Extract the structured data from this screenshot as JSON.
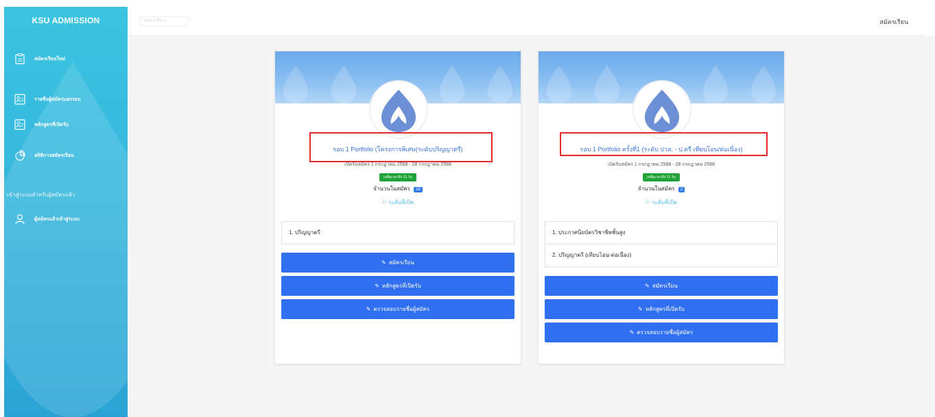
{
  "sidebar": {
    "title": "KSU ADMISSION",
    "items": [
      {
        "label": "สมัครเรียนใหม่",
        "icon": "clipboard-icon"
      },
      {
        "label": "รายชื่อผู้สมัครแยกรอบ",
        "icon": "user-list-icon"
      },
      {
        "label": "หลักสูตรที่เปิดรับ",
        "icon": "course-icon"
      },
      {
        "label": "สถิติการสมัครเรียน",
        "icon": "pie-chart-icon"
      }
    ],
    "section_label": "เข้าสู่ระบบสำหรับผู้สมัครแล้ว",
    "login_item": {
      "label": "ผู้สมัครแล้วเข้าสู่ระบบ",
      "icon": "user-icon"
    }
  },
  "topbar": {
    "crumb": "สมัครเรียน",
    "right_link": "สมัครเรียน"
  },
  "cards": [
    {
      "title": "รอบ 1 Portfolio (โครงการพิเศษ(ระดับปริญญาตรี)",
      "period": "เปิดรับสมัคร 1 กรกฎาคม 2568 - 28 กรกฎาคม 2568",
      "badge": "เหลือเวลาอีก 11 วัน",
      "count_label": "จำนวนในสมัคร",
      "count": "18",
      "levels_label": "ระดับที่เปิด",
      "levels": [
        "1. ปริญญาตรี"
      ],
      "buttons": {
        "apply": "สมัครเรียน",
        "courses": "หลักสูตรที่เปิดรับ",
        "check": "ตรวจสอบรายชื่อผู้สมัคร"
      }
    },
    {
      "title": "รอบ 1 Portfolio ครั้งที่1 (ระดับ ปวส. - ป.ตรี เทียบโอน/ต่อเนื่อง)",
      "period": "เปิดรับสมัคร 1 กรกฎาคม 2568 - 28 กรกฎาคม 2568",
      "badge": "เหลือเวลาอีก 11 วัน",
      "count_label": "จำนวนในสมัคร",
      "count": "2",
      "levels_label": "ระดับที่เปิด",
      "levels": [
        "1. ประกาศนียบัตรวิชาชีพชั้นสูง",
        "2. ปริญญาตรี (เทียบโอน-ต่อเนื่อง)"
      ],
      "buttons": {
        "apply": "สมัครเรียน",
        "courses": "หลักสูตรที่เปิดรับ",
        "check": "ตรวจสอบรายชื่อผู้สมัคร"
      }
    }
  ],
  "colors": {
    "sidebar": "#35b5dc",
    "button": "#2f6ff0",
    "title": "#3a74d8",
    "highlight": "#e5282c",
    "badge": "#22a33a"
  }
}
